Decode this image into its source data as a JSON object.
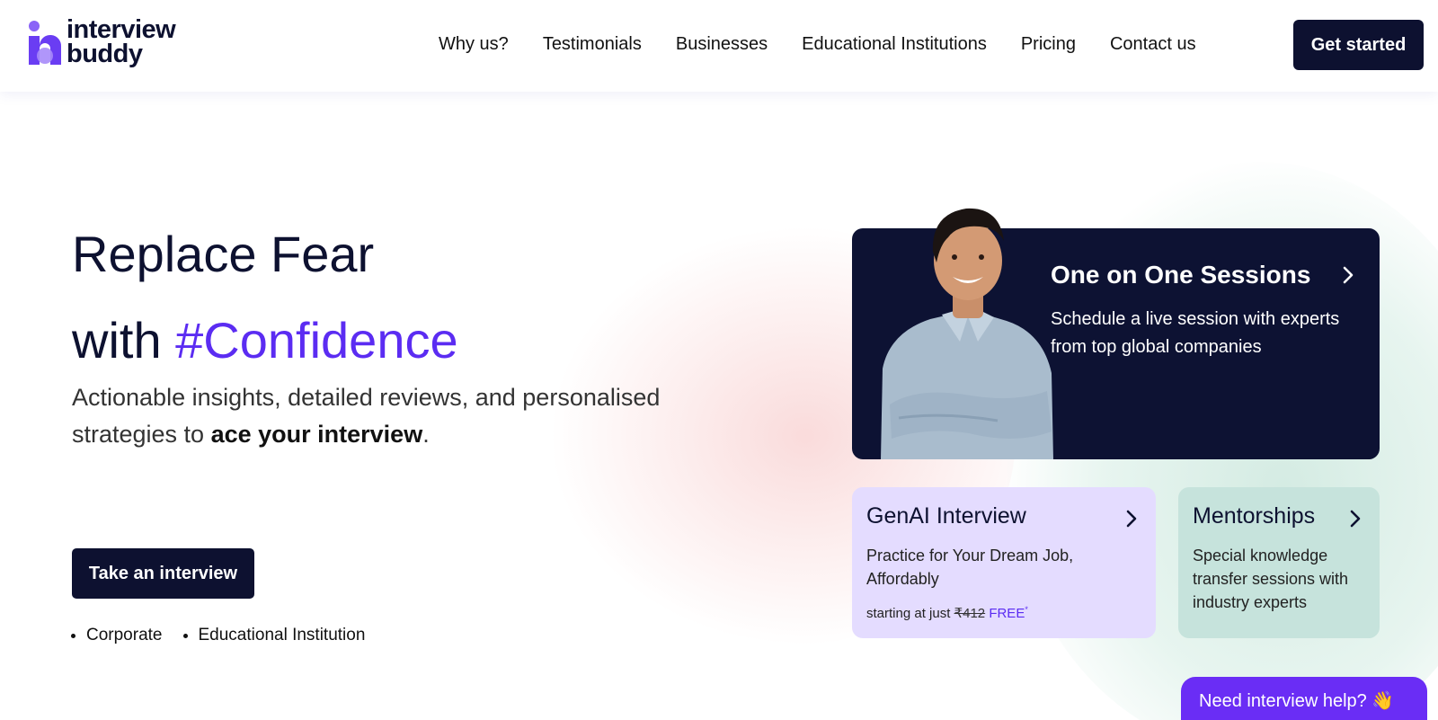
{
  "brand": {
    "line1": "interview",
    "line2": "buddy",
    "colors": {
      "primary": "#0d1130",
      "accent": "#5b2cf2"
    }
  },
  "nav": {
    "items": [
      {
        "label": "Why us?"
      },
      {
        "label": "Testimonials"
      },
      {
        "label": "Businesses"
      },
      {
        "label": "Educational Institutions"
      },
      {
        "label": "Pricing"
      },
      {
        "label": "Contact us"
      }
    ],
    "cta": "Get started"
  },
  "hero": {
    "title_line1": "Replace Fear",
    "title_line2_prefix": "with",
    "title_line2_accent": "#Confidence",
    "subtitle_part1": "Actionable insights, detailed reviews, and personalised strategies to",
    "subtitle_bold": "ace your interview",
    "subtitle_end": ".",
    "button": "Take an interview",
    "bullets": [
      "Corporate",
      "Educational Institution"
    ]
  },
  "cards": {
    "main": {
      "title": "One on One Sessions",
      "description": "Schedule a live session with experts from top global companies"
    },
    "genai": {
      "title": "GenAI Interview",
      "description": "Practice for Your Dream Job, Affordably",
      "price_prefix": "starting at just",
      "old_price": "₹412",
      "new_price": "FREE",
      "asterisk": "*"
    },
    "mentor": {
      "title": "Mentorships",
      "description": "Special knowledge transfer sessions with industry experts"
    }
  },
  "help": {
    "label": "Need interview help?",
    "emoji": "👋"
  }
}
